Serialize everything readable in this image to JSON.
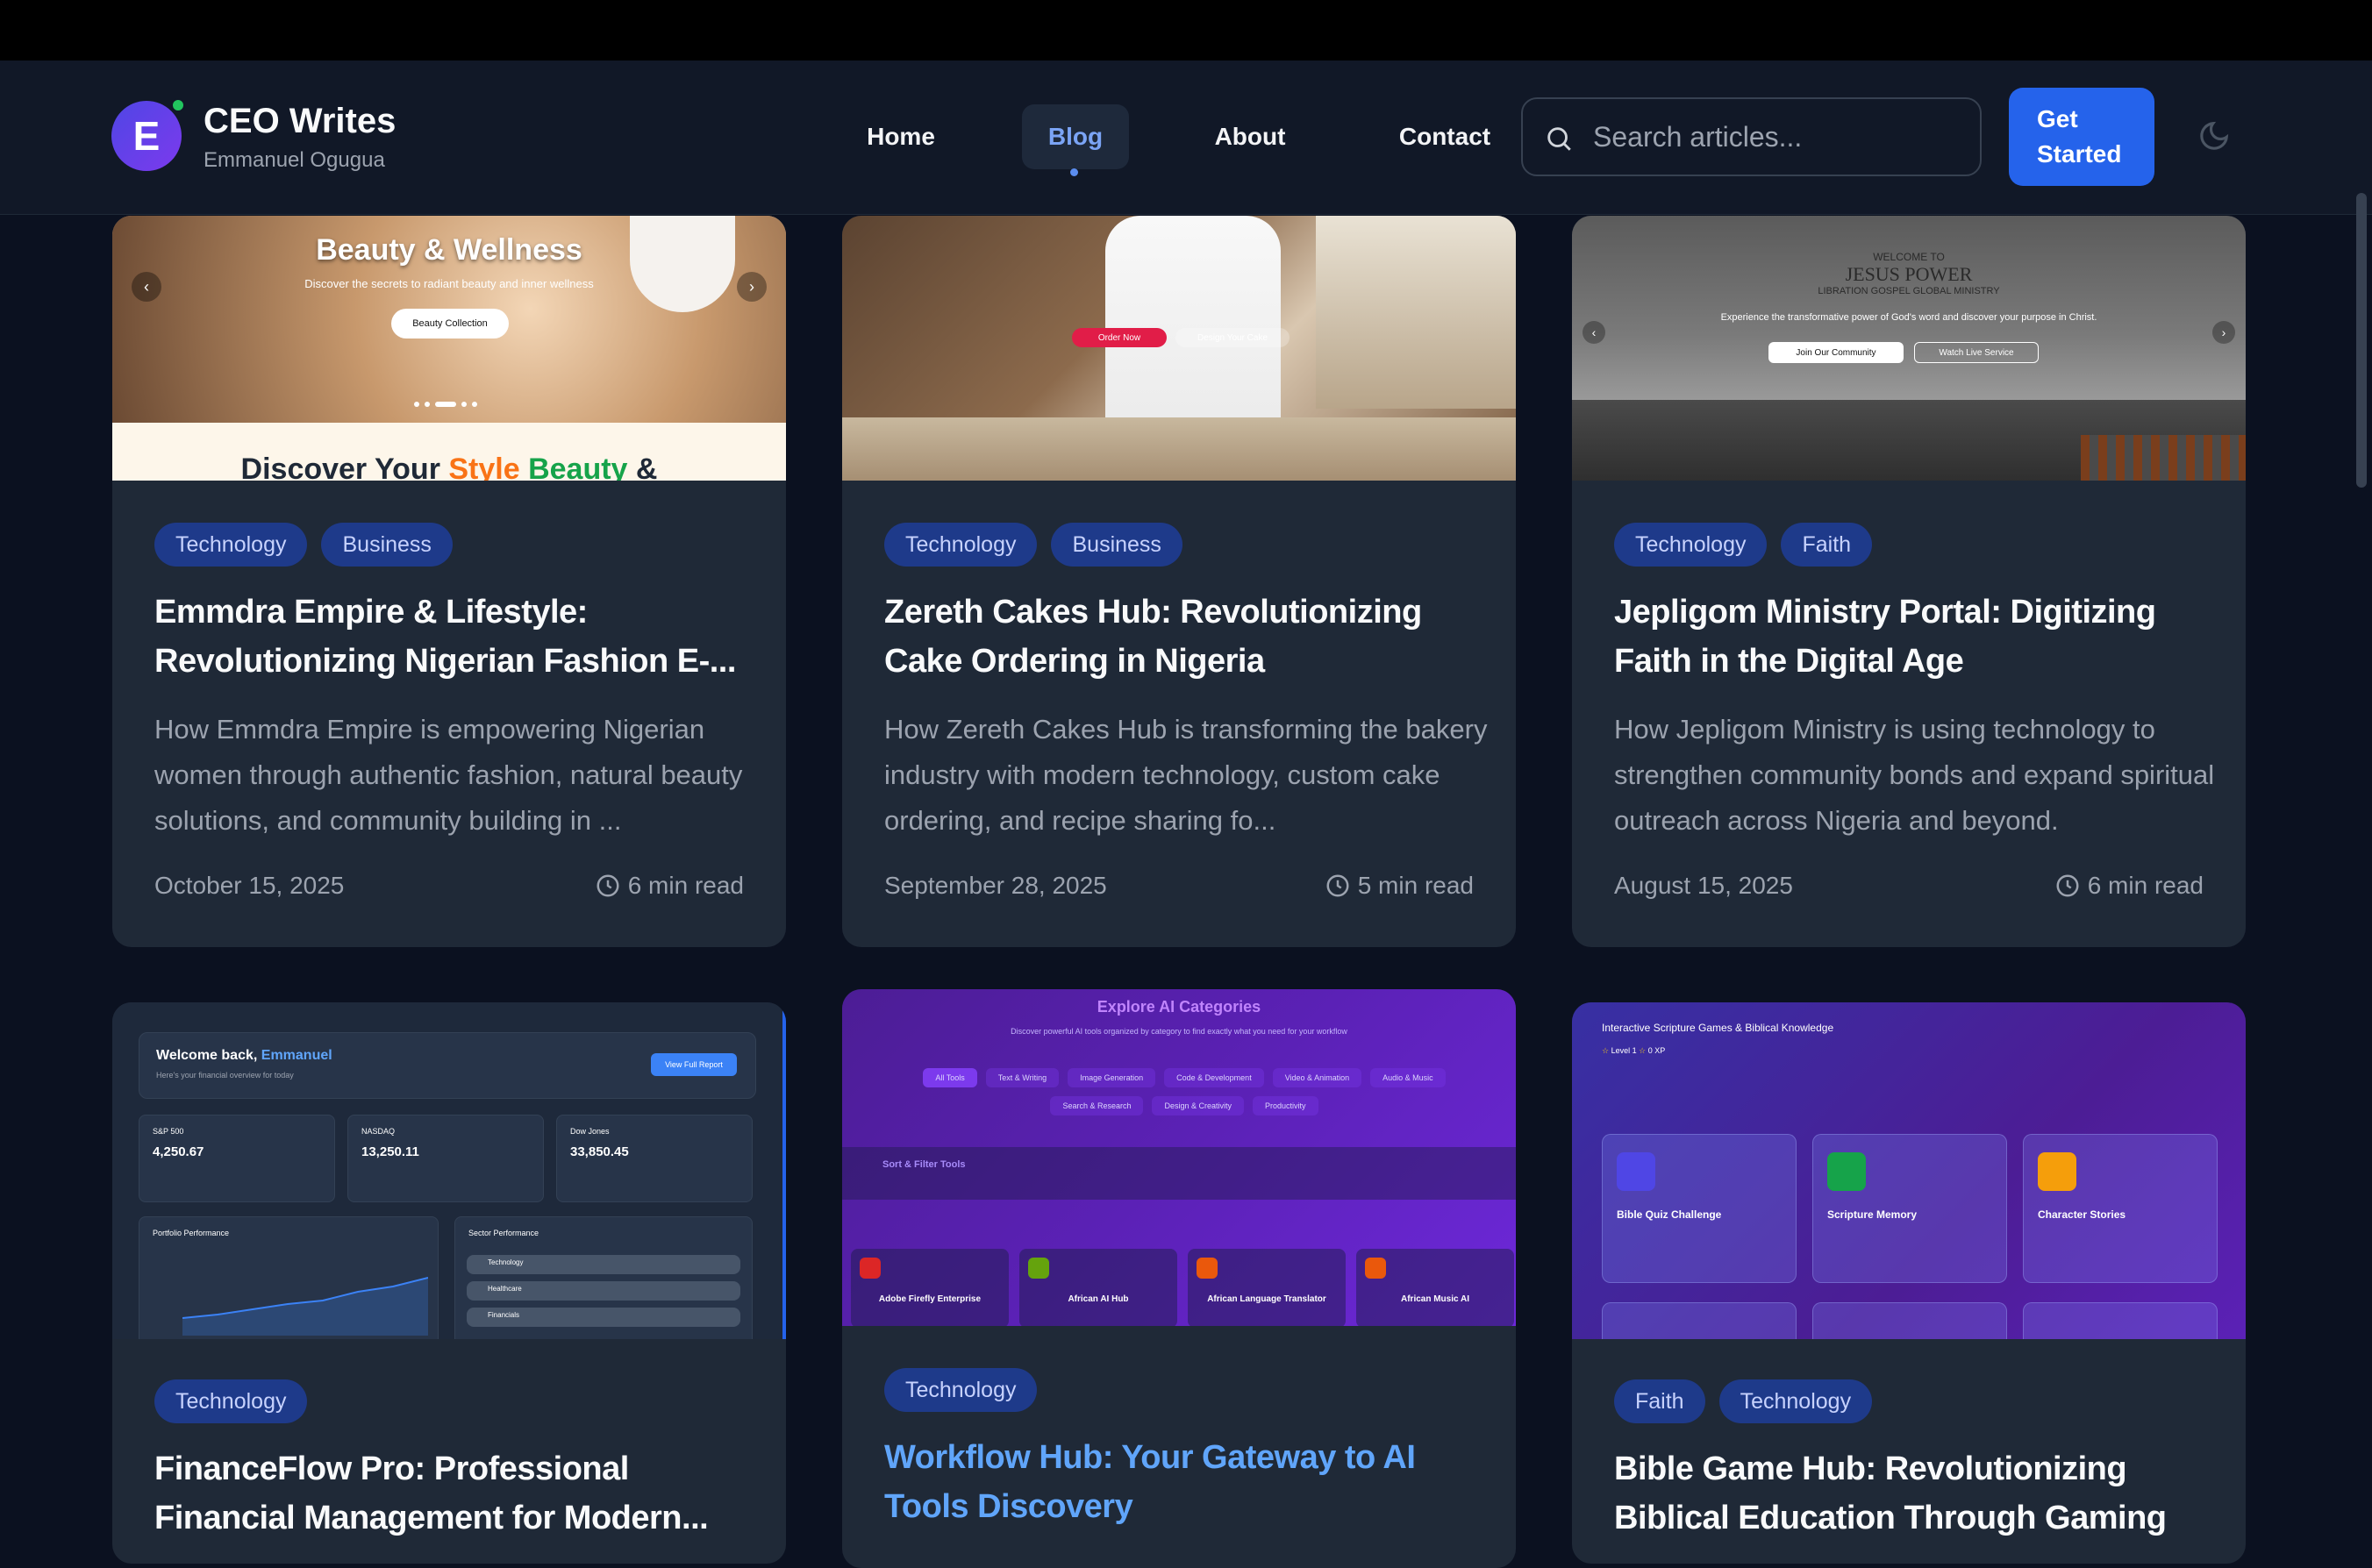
{
  "header": {
    "logo_letter": "E",
    "brand_title": "CEO Writes",
    "brand_subtitle": "Emmanuel Ogugua",
    "nav": [
      {
        "label": "Home",
        "active": false
      },
      {
        "label": "Blog",
        "active": true
      },
      {
        "label": "About",
        "active": false
      },
      {
        "label": "Contact",
        "active": false
      }
    ],
    "search_placeholder": "Search articles...",
    "cta_label": "Get Started"
  },
  "posts": [
    {
      "tags": [
        "Technology",
        "Business"
      ],
      "title": "Emmdra Empire & Lifestyle: Revolutionizing Nigerian Fashion E-...",
      "excerpt": "How Emmdra Empire is empowering Nigerian women through authentic fashion, natural beauty solutions, and community building in ...",
      "date": "October 15, 2025",
      "read_time": "6 min read",
      "thumb": {
        "heading": "Beauty & Wellness",
        "sub": "Discover the secrets to radiant beauty and inner wellness",
        "button": "Beauty Collection",
        "footer_a": "Discover Your ",
        "footer_b": "Style",
        "footer_c": "Beauty",
        "footer_d": " &"
      }
    },
    {
      "tags": [
        "Technology",
        "Business"
      ],
      "title": "Zereth Cakes Hub: Revolutionizing Cake Ordering in Nigeria",
      "excerpt": "How Zereth Cakes Hub is transforming the bakery industry with modern technology, custom cake ordering, and recipe sharing fo...",
      "date": "September 28, 2025",
      "read_time": "5 min read",
      "thumb": {
        "button_a": "Order Now",
        "button_b": "Design Your Cake"
      }
    },
    {
      "tags": [
        "Technology",
        "Faith"
      ],
      "title": "Jepligom Ministry Portal: Digitizing Faith in the Digital Age",
      "excerpt": "How Jepligom Ministry is using technology to strengthen community bonds and expand spiritual outreach across Nigeria and beyond.",
      "date": "August 15, 2025",
      "read_time": "6 min read",
      "thumb": {
        "line1": "WELCOME TO",
        "line2": "JESUS POWER",
        "line3": "LIBRATION GOSPEL GLOBAL MINISTRY",
        "sub": "Experience the transformative power of God's word and discover your purpose in Christ.",
        "button_a": "Join Our Community",
        "button_b": "Watch Live Service"
      }
    },
    {
      "tags": [
        "Technology"
      ],
      "title": "FinanceFlow Pro: Professional Financial Management for Modern...",
      "thumb": {
        "welcome": "Welcome back, ",
        "user": "Emmanuel",
        "sub": "Here's your financial overview for today",
        "button": "View Full Report",
        "cards": [
          {
            "name": "S&P 500",
            "value": "4,250.67"
          },
          {
            "name": "NASDAQ",
            "value": "13,250.11"
          },
          {
            "name": "Dow Jones",
            "value": "33,850.45"
          }
        ],
        "panel_a": "Portfolio Performance",
        "panel_b": "Sector Performance",
        "sectors": [
          "Technology",
          "Healthcare",
          "Financials"
        ]
      }
    },
    {
      "tags": [
        "Technology"
      ],
      "title": "Workflow Hub: Your Gateway to AI Tools Discovery",
      "thumb": {
        "heading": "Explore AI Categories",
        "sub": "Discover powerful AI tools organized by category to find exactly what you need for your workflow",
        "chips": [
          "All Tools",
          "Text & Writing",
          "Image Generation",
          "Code & Development",
          "Video & Animation",
          "Audio & Music",
          "Search & Research",
          "Design & Creativity",
          "Productivity"
        ],
        "sort_title": "Sort & Filter Tools",
        "tools": [
          "Adobe Firefly Enterprise",
          "African AI Hub",
          "African Language Translator",
          "African Music AI"
        ]
      }
    },
    {
      "tags": [
        "Faith",
        "Technology"
      ],
      "title": "Bible Game Hub: Revolutionizing Biblical Education Through Gaming",
      "thumb": {
        "sub": "Interactive Scripture Games & Biblical Knowledge",
        "level": "Level 1",
        "xp": "0 XP",
        "games": [
          "Bible Quiz Challenge",
          "Scripture Memory",
          "Character Stories"
        ]
      }
    }
  ]
}
